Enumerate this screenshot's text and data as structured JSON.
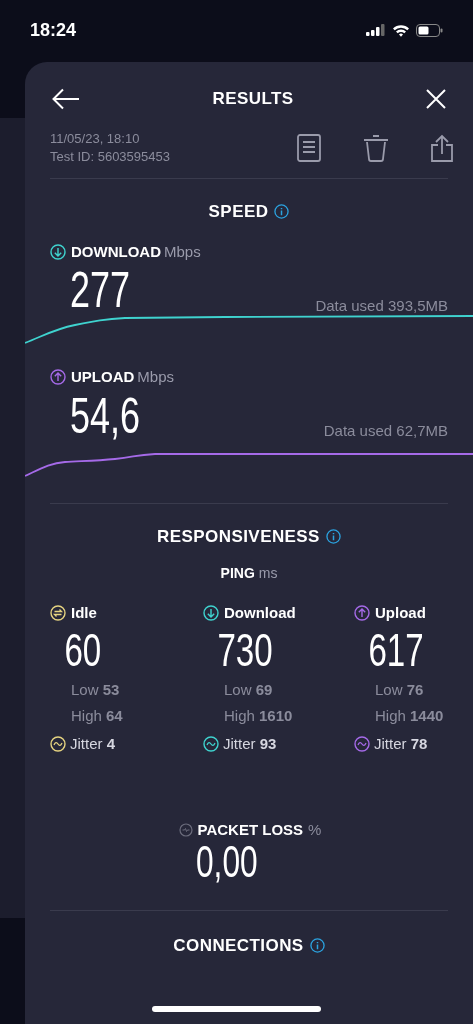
{
  "status_bar": {
    "time": "18:24"
  },
  "header": {
    "title": "RESULTS"
  },
  "test": {
    "date": "11/05/23, 18:10",
    "test_id": "Test ID: 5603595453"
  },
  "speed": {
    "title": "SPEED",
    "metrics": [
      {
        "kind": "download",
        "label": "DOWNLOAD",
        "unit": "Mbps",
        "value": "277",
        "data_used": "Data used 393,5MB"
      },
      {
        "kind": "upload",
        "label": "UPLOAD",
        "unit": "Mbps",
        "value": "54,6",
        "data_used": "Data used 62,7MB"
      }
    ]
  },
  "responsiveness": {
    "title": "RESPONSIVENESS",
    "ping_label": "PING",
    "ping_unit": "ms",
    "columns": [
      {
        "kind": "idle",
        "label": "Idle",
        "value": "60",
        "low": "Low **53**",
        "high": "High **64**",
        "jitter": "Jitter **4**"
      },
      {
        "kind": "download",
        "label": "Download",
        "value": "730",
        "low": "Low **69**",
        "high": "High **1610**",
        "jitter": "Jitter **93**"
      },
      {
        "kind": "upload",
        "label": "Upload",
        "value": "617",
        "low": "Low **76**",
        "high": "High **1440**",
        "jitter": "Jitter **78**"
      }
    ]
  },
  "packet_loss": {
    "label": "PACKET LOSS",
    "unit": "%",
    "value": "0,00"
  },
  "connections": {
    "title": "CONNECTIONS"
  }
}
